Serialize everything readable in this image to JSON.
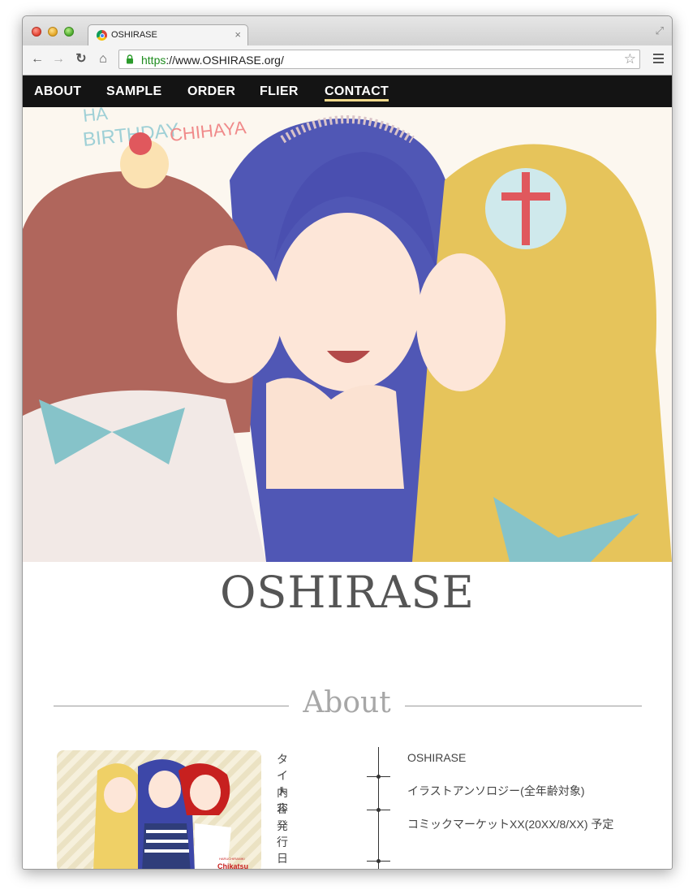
{
  "browser": {
    "tab_title": "OSHIRASE",
    "url_scheme": "https",
    "url_rest": "://www.OSHIRASE.org/"
  },
  "site_nav": {
    "items": [
      "ABOUT",
      "SAMPLE",
      "ORDER",
      "FLIER",
      "CONTACT"
    ],
    "active": "CONTACT",
    "accent_color": "#f0d98a",
    "background": "#141414"
  },
  "hero": {
    "text_line1": "HA",
    "text_line2": "BIRTHDAY",
    "text_line3": "CHIHAYA"
  },
  "page": {
    "title": "OSHIRASE",
    "section_title": "About"
  },
  "cover": {
    "caption_small": "HARUCHIRANIKI",
    "caption_logo": "Chikatsu"
  },
  "about_table": [
    {
      "key": "タイトル",
      "value": "OSHIRASE"
    },
    {
      "key": "内容",
      "value": "イラストアンソロジー(全年齢対象)"
    },
    {
      "key": "発行日",
      "value": "コミックマーケットXX(20XX/8/XX) 予定"
    }
  ]
}
